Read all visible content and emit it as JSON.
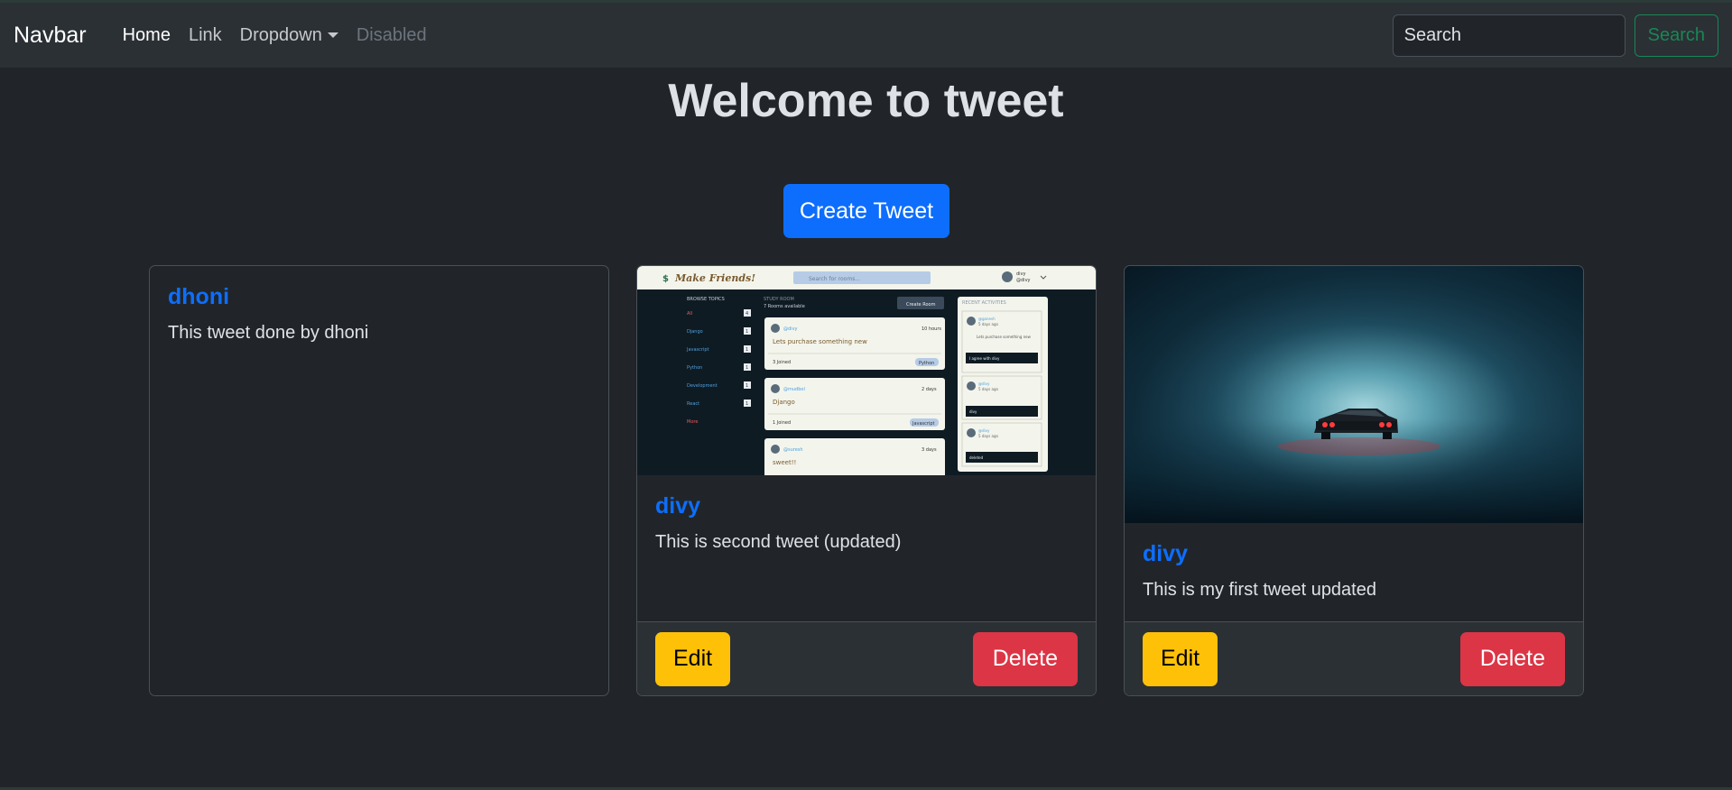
{
  "navbar": {
    "brand": "Navbar",
    "links": [
      {
        "label": "Home"
      },
      {
        "label": "Link"
      },
      {
        "label": "Dropdown"
      },
      {
        "label": "Disabled"
      }
    ],
    "search_placeholder": "Search",
    "search_button": "Search"
  },
  "main": {
    "title": "Welcome to tweet",
    "create_button": "Create Tweet"
  },
  "tweets": [
    {
      "author": "dhoni",
      "text": "This tweet done by dhoni"
    },
    {
      "author": "divy",
      "text": "This is second tweet (updated)",
      "edit": "Edit",
      "delete": "Delete"
    },
    {
      "author": "divy",
      "text": "This is my first tweet updated",
      "edit": "Edit",
      "delete": "Delete"
    }
  ],
  "screenshot_image": {
    "app_title": "Make Friends!",
    "search_placeholder": "Search for rooms...",
    "user_name": "divy",
    "user_handle": "@divy",
    "browse_heading": "BROWSE TOPICS",
    "topics": [
      {
        "name": "All",
        "count": "4"
      },
      {
        "name": "Django",
        "count": "1"
      },
      {
        "name": "Javascript",
        "count": "1"
      },
      {
        "name": "Python",
        "count": "1"
      },
      {
        "name": "Development",
        "count": "1"
      },
      {
        "name": "React",
        "count": "1"
      }
    ],
    "more_label": "More",
    "study_room_heading": "STUDY ROOM",
    "rooms_available": "7 Rooms available",
    "create_room": "Create Room",
    "rooms": [
      {
        "host": "@divy",
        "time": "10 hours",
        "title": "Lets purchase something new",
        "joined": "3 Joined",
        "tag": "Python"
      },
      {
        "host": "@mudbol",
        "time": "2 days",
        "title": "Django",
        "joined": "1 Joined",
        "tag": "Javascript"
      },
      {
        "host": "@suresh",
        "time": "3 days",
        "title": "sweet!!",
        "joined": "",
        "tag": ""
      }
    ],
    "recent_heading": "RECENT ACTIVITIES",
    "activities": [
      {
        "user": "@ganesh",
        "time": "5 days ago",
        "text": "Lets purchase something new",
        "note": "I agree with divy"
      },
      {
        "user": "@divy",
        "time": "5 days ago",
        "text": "",
        "note": "divy"
      },
      {
        "user": "@divy",
        "time": "5 days ago",
        "text": "",
        "note": "deleted"
      }
    ]
  },
  "colors": {
    "primary": "#0d6efd",
    "warning": "#ffc107",
    "danger": "#dc3545",
    "success": "#198754",
    "background": "#212529"
  }
}
